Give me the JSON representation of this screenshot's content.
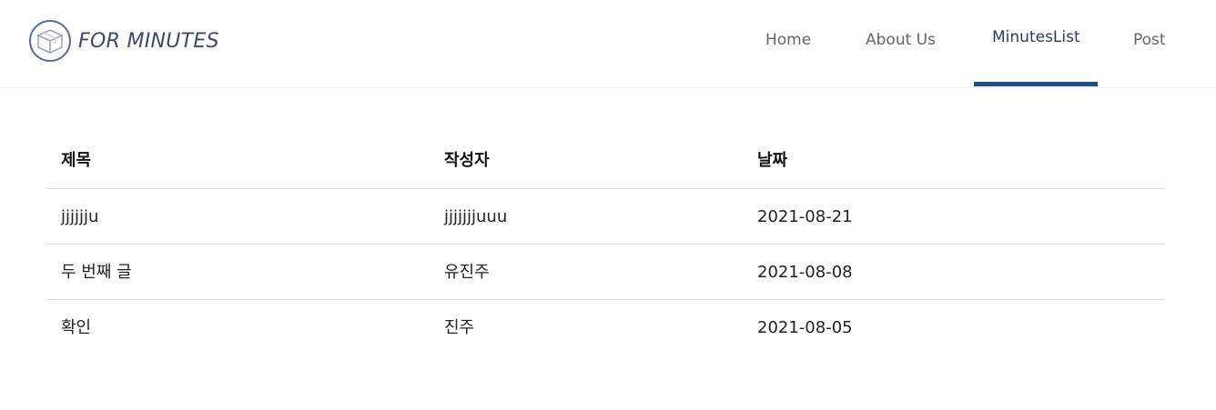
{
  "brand": {
    "name": "FOR MINUTES",
    "logo_icon": "box-icon"
  },
  "nav": {
    "items": [
      {
        "label": "Home",
        "active": false
      },
      {
        "label": "About Us",
        "active": false
      },
      {
        "label": "MinutesList",
        "active": true
      },
      {
        "label": "Post",
        "active": false
      }
    ],
    "active_color": "#1f4f82"
  },
  "table": {
    "columns": [
      "제목",
      "작성자",
      "날짜"
    ],
    "rows": [
      {
        "title": "jjjjjju",
        "author": "jjjjjjjuuu",
        "date": "2021-08-21"
      },
      {
        "title": "두 번째 글",
        "author": "유진주",
        "date": "2021-08-08"
      },
      {
        "title": "확인",
        "author": "진주",
        "date": "2021-08-05"
      }
    ]
  }
}
